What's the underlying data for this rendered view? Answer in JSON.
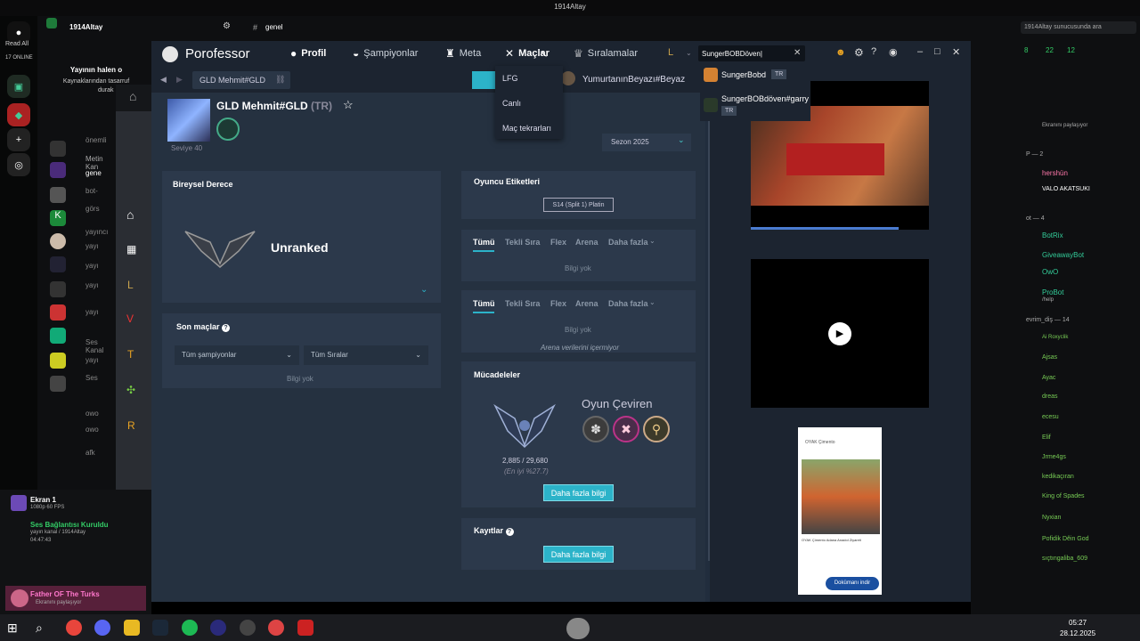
{
  "window_title": "1914Altay",
  "discord": {
    "server_name": "1914Altay",
    "channel_label": "genel",
    "read_all": "Read All",
    "online_count": "17 ONLINE",
    "notice_title": "Yayının halen o",
    "notice_body": "Kaynaklarından tasarruf",
    "notice_more": "durak",
    "left_channels": [
      "önemli",
      "Metin Kan",
      "gene",
      "bot-",
      "görs",
      "yayıncı",
      "yayı",
      "yayı",
      "yayı",
      "yayı",
      "Ses Kanal",
      "yayı",
      "Ses",
      "owo",
      "owo",
      "afk"
    ],
    "screen_share": {
      "title": "Ekran 1",
      "fps": "1080p 60 FPS",
      "status": "Ses Bağlantısı Kuruldu",
      "channel": "yayın kanal / 1914Altay",
      "time": "04:47:43"
    },
    "user": {
      "name": "Father OF The Turks",
      "status": "Ekranını paylaşıyor"
    },
    "right_search": "1914Altay sunucusunda ara",
    "right_stats": [
      "8",
      "22",
      "12"
    ],
    "right_members": [
      "Ekranını paylaşıyor",
      "hershün",
      "VALO AKATSUKI",
      "BotRix",
      "GiveawayBot",
      "OwO",
      "ProBot",
      "Ai Roxyclik",
      "Ajsas",
      "Ayac",
      "dreas",
      "ecesu",
      "Elif",
      "Jrme4gs",
      "kedikaçıran",
      "King of Spades",
      "Nyxian",
      "Pofidik Dêin God",
      "sıçtıngaliba_609"
    ],
    "right_labels": [
      "ot — 4",
      "evrim_diş — 14",
      "P — 2",
      "/help"
    ]
  },
  "porofessor": {
    "logo": "Porofessor",
    "nav": {
      "profil": "Profil",
      "sampiyonlar": "Şampiyonlar",
      "meta": "Meta",
      "maclar": "Maçlar",
      "siralamalar": "Sıralamalar"
    },
    "search_value": "SungerBOBDöven|",
    "suggestions": [
      {
        "name": "SungerBobd",
        "tag": "TR"
      },
      {
        "name": "SungerBOBdöven#garry",
        "tag": "TR"
      }
    ],
    "matches_menu": [
      "LFG",
      "Canlı",
      "Maç tekrarları"
    ],
    "breadcrumb": "GLD Mehmit#GLD",
    "other_player": "YumurtanınBeyazı#Beyaz",
    "player": {
      "name": "GLD Mehmit#GLD",
      "region": "(TR)",
      "level": "Seviye 40"
    },
    "season_select": "Sezon 2025",
    "ranked": {
      "title": "Bireysel Derece",
      "rank": "Unranked"
    },
    "recent": {
      "title": "Son maçlar",
      "champ_filter": "Tüm şampiyonlar",
      "queue_filter": "Tüm Sıralar",
      "no_data": "Bilgi yok"
    },
    "tags": {
      "title": "Oyuncu Etiketleri",
      "tag": "S14 (Split 1) Platin"
    },
    "tabs1": {
      "items": [
        "Tümü",
        "Tekli Sıra",
        "Flex",
        "Arena",
        "Daha fazla"
      ],
      "no_data": "Bilgi yok"
    },
    "tabs2": {
      "items": [
        "Tümü",
        "Tekli Sıra",
        "Flex",
        "Arena",
        "Daha fazla"
      ],
      "no_data": "Bilgi yok",
      "note": "Arena verilerini içermiyor"
    },
    "challenges": {
      "title": "Mücadeleler",
      "points": "2,885 / 29,680",
      "top": "(En iyi %27.7)",
      "title2": "Oyun Çeviren",
      "button": "Daha fazla bilgi"
    },
    "records": {
      "title": "Kayıtlar",
      "button": "Daha fazla bilgi"
    },
    "ad": {
      "button": "Dokümanı indir",
      "org": "OYAK Çimento",
      "caption": "OYAK Çimento Adana Anadol Ziyareti"
    }
  },
  "taskbar": {
    "time": "05:27",
    "date": "28.12.2025"
  },
  "colors": {
    "accent": "#2cb3c9",
    "bg": "#212d3d",
    "panel": "#2c394b"
  }
}
